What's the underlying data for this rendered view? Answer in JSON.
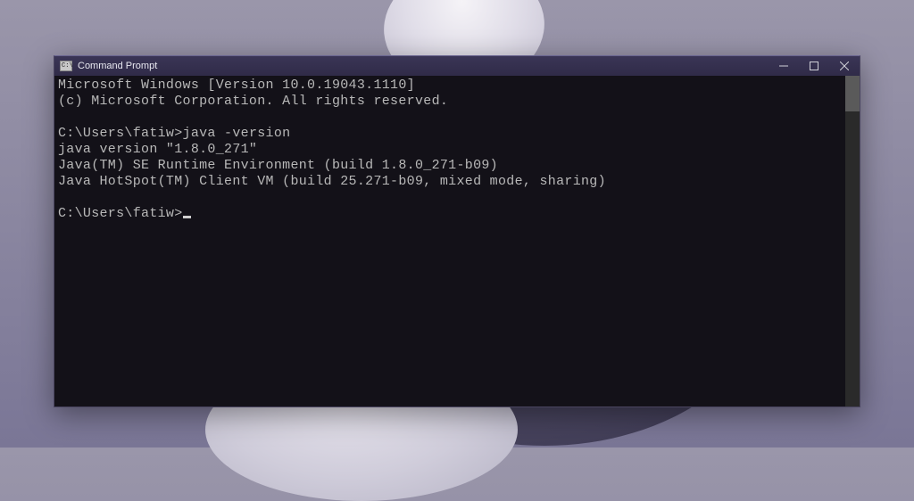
{
  "window": {
    "title": "Command Prompt"
  },
  "terminal": {
    "lines": {
      "l0": "Microsoft Windows [Version 10.0.19043.1110]",
      "l1": "(c) Microsoft Corporation. All rights reserved.",
      "l2": "",
      "l3_prompt": "C:\\Users\\fatiw>",
      "l3_cmd": "java -version",
      "l4": "java version \"1.8.0_271\"",
      "l5": "Java(TM) SE Runtime Environment (build 1.8.0_271-b09)",
      "l6": "Java HotSpot(TM) Client VM (build 25.271-b09, mixed mode, sharing)",
      "l7": "",
      "l8_prompt": "C:\\Users\\fatiw>"
    }
  }
}
